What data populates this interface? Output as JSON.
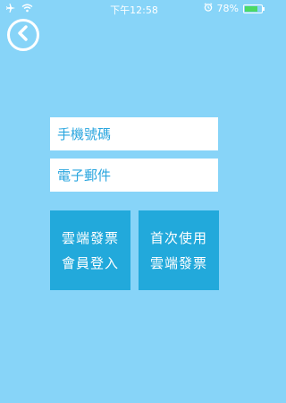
{
  "status_bar": {
    "time": "下午12:58",
    "battery_percent": "78%",
    "battery_level": 0.78,
    "battery_color": "#4cd964",
    "icons": [
      "airplane-icon",
      "wifi-icon",
      "alarm-icon",
      "battery-icon"
    ]
  },
  "nav": {
    "back_icon": "chevron-left-icon"
  },
  "form": {
    "phone_placeholder": "手機號碼",
    "email_placeholder": "電子郵件"
  },
  "actions": {
    "login": {
      "line1": "雲端發票",
      "line2": "會員登入"
    },
    "register": {
      "line1": "首次使用",
      "line2": "雲端發票"
    }
  },
  "colors": {
    "background": "#87d4f8",
    "tile": "#22a9db",
    "placeholder": "#2aa6df"
  }
}
